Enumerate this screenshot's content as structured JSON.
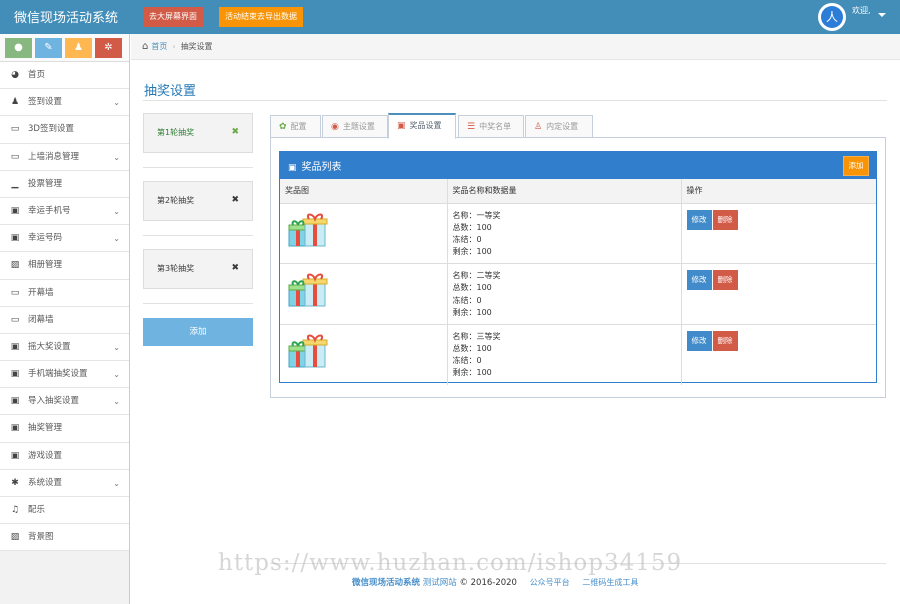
{
  "header": {
    "brand": "微信现场活动系统",
    "btn_bigscreen": "去大屏幕界面",
    "btn_export": "活动结束去导出数据",
    "welcome": "欢迎,",
    "avatar_glyph": "人"
  },
  "sidebar": {
    "items": [
      {
        "label": "首页",
        "icon": "dashboard-icon",
        "expand": false
      },
      {
        "label": "签到设置",
        "icon": "users-icon",
        "expand": true
      },
      {
        "label": "3D签到设置",
        "icon": "desktop-icon",
        "expand": false
      },
      {
        "label": "上墙消息管理",
        "icon": "desktop-icon",
        "expand": true
      },
      {
        "label": "投票管理",
        "icon": "signal-icon",
        "expand": false
      },
      {
        "label": "幸运手机号",
        "icon": "gift-icon",
        "expand": true
      },
      {
        "label": "幸运号码",
        "icon": "gift-icon",
        "expand": true
      },
      {
        "label": "相册管理",
        "icon": "picture-icon",
        "expand": false
      },
      {
        "label": "开幕墙",
        "icon": "desktop-icon",
        "expand": false
      },
      {
        "label": "闭幕墙",
        "icon": "desktop-icon",
        "expand": false
      },
      {
        "label": "摇大奖设置",
        "icon": "gift-icon",
        "expand": true
      },
      {
        "label": "手机端抽奖设置",
        "icon": "gift-icon",
        "expand": true
      },
      {
        "label": "导入抽奖设置",
        "icon": "gift-icon",
        "expand": true
      },
      {
        "label": "抽奖管理",
        "icon": "gift-icon",
        "expand": false
      },
      {
        "label": "游戏设置",
        "icon": "gift-icon",
        "expand": false
      },
      {
        "label": "系统设置",
        "icon": "gear-icon",
        "expand": true
      },
      {
        "label": "配乐",
        "icon": "music-icon",
        "expand": false
      },
      {
        "label": "背景图",
        "icon": "picture-icon",
        "expand": false
      }
    ]
  },
  "breadcrumb": {
    "home": "首页",
    "current": "抽奖设置"
  },
  "page": {
    "title": "抽奖设置"
  },
  "rounds": [
    {
      "label": "第1轮抽奖"
    },
    {
      "label": "第2轮抽奖"
    },
    {
      "label": "第3轮抽奖"
    }
  ],
  "rounds_add": "添加",
  "tabs": [
    {
      "label": "配置"
    },
    {
      "label": "主题设置"
    },
    {
      "label": "奖品设置"
    },
    {
      "label": "中奖名单"
    },
    {
      "label": "内定设置"
    }
  ],
  "prizes": {
    "title": "奖品列表",
    "add": "添加",
    "columns": [
      "奖品图",
      "奖品名称和数据量",
      "操作"
    ],
    "rows": [
      {
        "name": "名称：一等奖",
        "total": "总数：100",
        "frozen": "冻结：0",
        "left": "剩余：100"
      },
      {
        "name": "名称：二等奖",
        "total": "总数：100",
        "frozen": "冻结：0",
        "left": "剩余：100"
      },
      {
        "name": "名称：三等奖",
        "total": "总数：100",
        "frozen": "冻结：0",
        "left": "剩余：100"
      }
    ],
    "edit": "修改",
    "delete": "删除"
  },
  "footer": {
    "brand": "微信现场活动系统",
    "site": "测试网站",
    "copy": "© 2016-2020",
    "link1": "公众号平台",
    "link2": "二维码生成工具"
  },
  "watermark": "https://www.huzhan.com/ishop34159"
}
